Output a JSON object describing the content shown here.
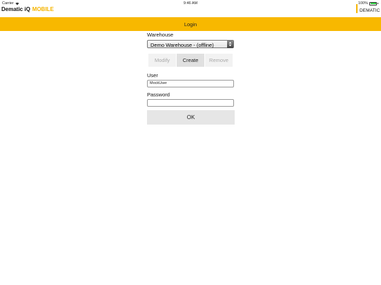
{
  "status_bar": {
    "carrier": "Carrier",
    "time": "9:46 AM",
    "battery_percent": "100%",
    "battery_level": 1.0
  },
  "header": {
    "brand": "Dematic iQ",
    "brand_sub": "MOBILE",
    "logo_text": "DEMATIC"
  },
  "title_bar": {
    "title": "Login"
  },
  "form": {
    "warehouse_label": "Warehouse",
    "warehouse_value": "Demo Warehouse - (offline)",
    "buttons": {
      "modify": "Modify",
      "create": "Create",
      "remove": "Remove"
    },
    "user_label": "User",
    "user_value": "MockUser",
    "password_label": "Password",
    "password_value": "",
    "ok_label": "OK"
  },
  "colors": {
    "accent": "#f8b800",
    "battery": "#2ecc40"
  }
}
